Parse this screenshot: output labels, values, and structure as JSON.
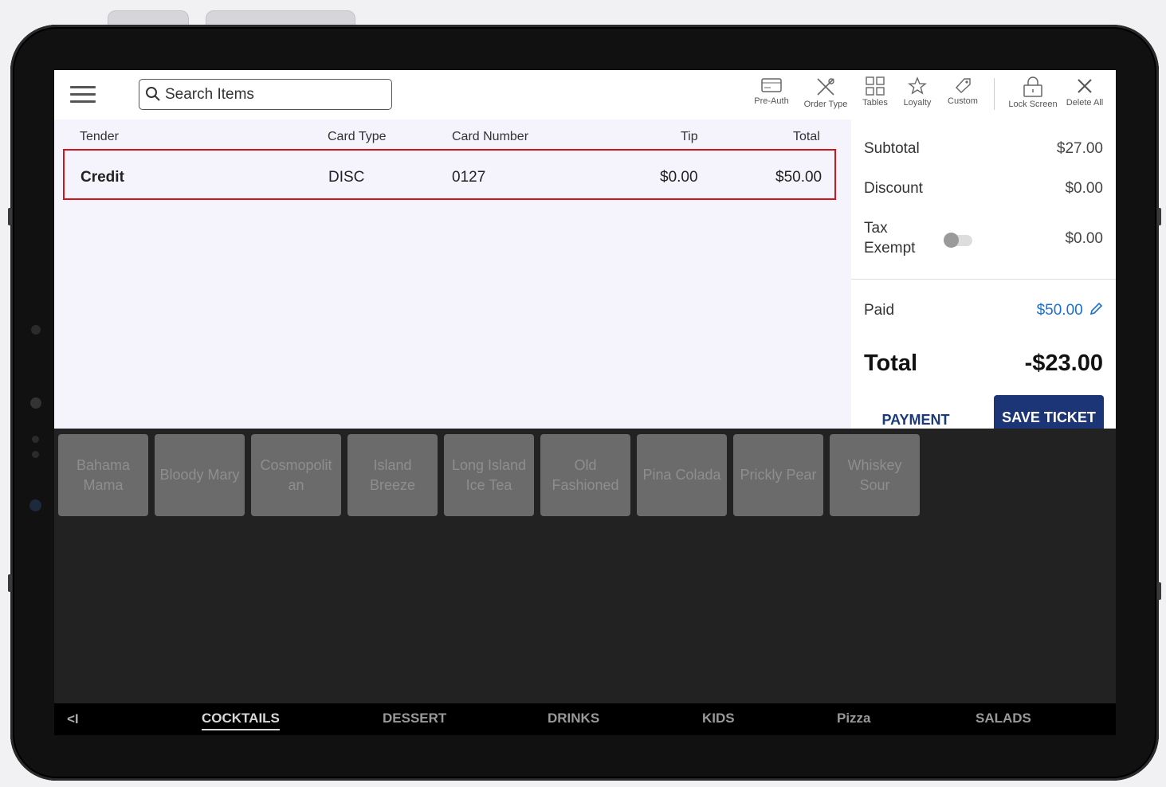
{
  "toolbar": {
    "search_placeholder": "Search Items",
    "tools": [
      {
        "label": "Pre-Auth",
        "icon": "card-icon"
      },
      {
        "label": "Order Type",
        "icon": "utensils-icon"
      },
      {
        "label": "Tables",
        "icon": "grid-icon"
      },
      {
        "label": "Loyalty",
        "icon": "star-icon"
      },
      {
        "label": "Custom",
        "icon": "tag-icon"
      },
      {
        "label": "Lock Screen",
        "icon": "lock-icon"
      },
      {
        "label": "Delete All",
        "icon": "close-icon"
      }
    ]
  },
  "tender_table": {
    "headers": [
      "Tender",
      "Card Type",
      "Card Number",
      "Tip",
      "Total"
    ],
    "rows": [
      {
        "tender": "Credit",
        "card_type": "DISC",
        "card_number": "0127",
        "tip": "$0.00",
        "total": "$50.00"
      }
    ]
  },
  "totals": {
    "subtotal_label": "Subtotal",
    "subtotal_value": "$27.00",
    "discount_label": "Discount",
    "discount_value": "$0.00",
    "tax_label_1": "Tax",
    "tax_label_2": "Exempt",
    "tax_value": "$0.00",
    "paid_label": "Paid",
    "paid_value": "$50.00",
    "total_label": "Total",
    "total_value": "-$23.00",
    "payment_button": "PAYMENT",
    "save_button": "SAVE TICKET"
  },
  "items": [
    [
      "Bahama",
      "Mama"
    ],
    [
      "Bloody Mary"
    ],
    [
      "Cosmopolit",
      "an"
    ],
    [
      "Island",
      "Breeze"
    ],
    [
      "Long Island",
      "Ice Tea"
    ],
    [
      "Old",
      "Fashioned"
    ],
    [
      "Pina Colada"
    ],
    [
      "Prickly Pear"
    ],
    [
      "Whiskey",
      "Sour"
    ]
  ],
  "categories": {
    "back_label": "<I",
    "list": [
      "COCKTAILS",
      "DESSERT",
      "DRINKS",
      "KIDS",
      "Pizza",
      "SALADS"
    ],
    "active": "COCKTAILS"
  },
  "colors": {
    "accent": "#1c3577",
    "highlight_border": "#d2141b",
    "paid_link": "#1a6fd6"
  }
}
